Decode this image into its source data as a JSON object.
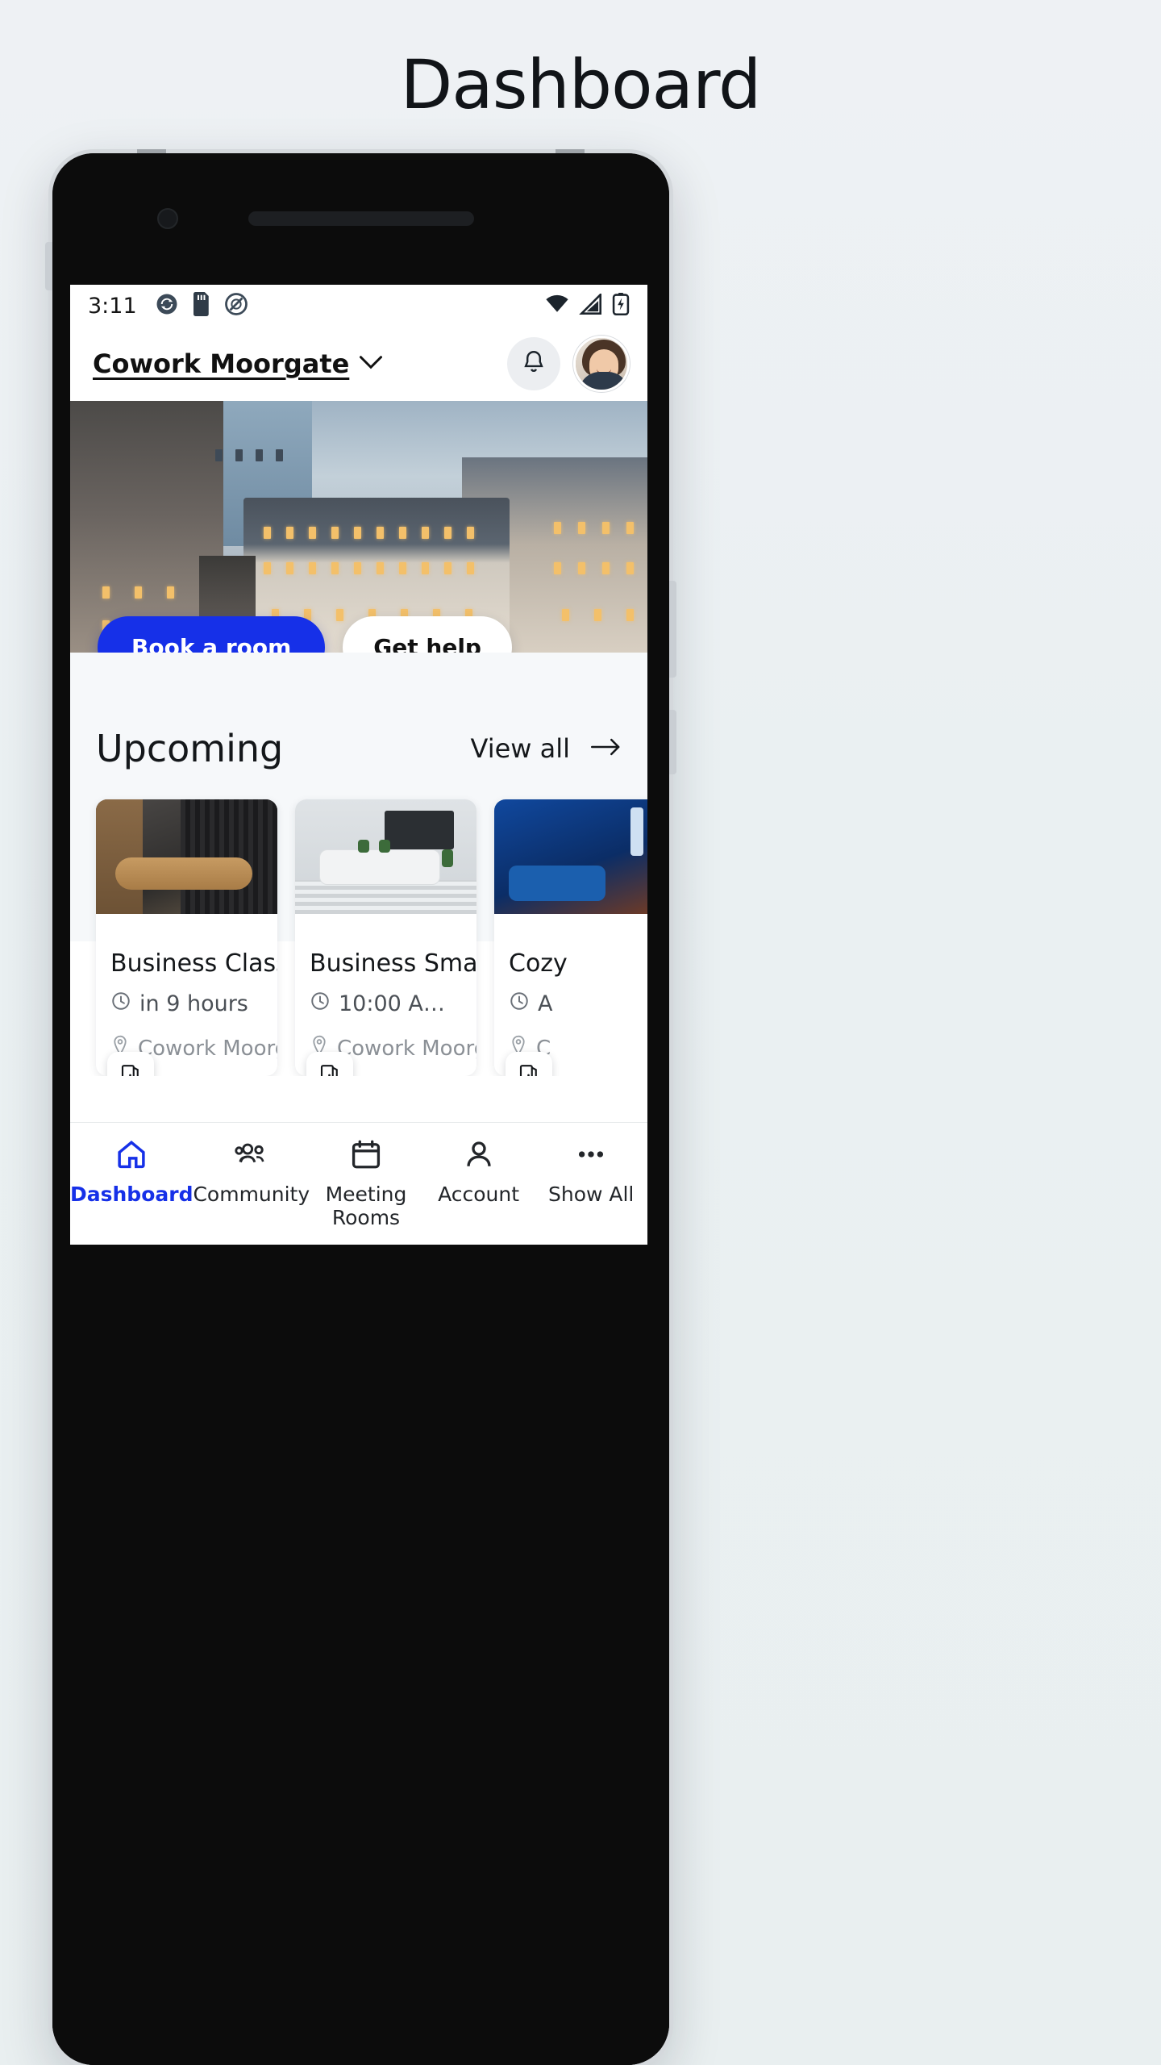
{
  "page": {
    "title": "Dashboard"
  },
  "status_bar": {
    "time": "3:11",
    "left_icons": [
      "sync-icon",
      "sd-card-icon",
      "do-not-disturb-icon"
    ],
    "right_icons": [
      "wifi-icon",
      "cellular-signal-icon",
      "battery-charging-icon"
    ]
  },
  "app_header": {
    "location": "Cowork Moorgate",
    "location_chevron": "chevron-down-icon",
    "notifications_icon": "bell-icon",
    "avatar": "user-avatar"
  },
  "hero": {
    "alt": "aerial view of city office buildings",
    "primary_button": "Book a room",
    "secondary_button": "Get help"
  },
  "upcoming": {
    "title": "Upcoming",
    "view_all": "View all",
    "view_all_icon": "arrow-right-icon",
    "cards": [
      {
        "name": "Business Classy",
        "time": "in 9 hours",
        "location": "Cowork Moorgate",
        "badge_icon": "door-icon",
        "clock_icon": "clock-icon",
        "pin_icon": "map-pin-icon"
      },
      {
        "name": "Business Smart",
        "time": "10:00 A…",
        "location": "Cowork Moorgate",
        "badge_icon": "door-icon",
        "clock_icon": "clock-icon",
        "pin_icon": "map-pin-icon"
      },
      {
        "name": "Cozy",
        "time": "A",
        "location": "C",
        "badge_icon": "door-icon",
        "clock_icon": "clock-icon",
        "pin_icon": "map-pin-icon"
      }
    ]
  },
  "bottom_nav": {
    "items": [
      {
        "label": "Dashboard",
        "icon": "home-icon",
        "active": true
      },
      {
        "label": "Community",
        "icon": "people-icon",
        "active": false
      },
      {
        "label": "Meeting Rooms",
        "icon": "calendar-icon",
        "active": false
      },
      {
        "label": "Account",
        "icon": "person-icon",
        "active": false
      },
      {
        "label": "Show All",
        "icon": "ellipsis-icon",
        "active": false
      }
    ]
  },
  "colors": {
    "accent": "#1630e8",
    "page_bg": "#eef1f4",
    "section_bg": "#f6f8fa",
    "text_primary": "#14171a",
    "text_muted": "#8b9096"
  }
}
